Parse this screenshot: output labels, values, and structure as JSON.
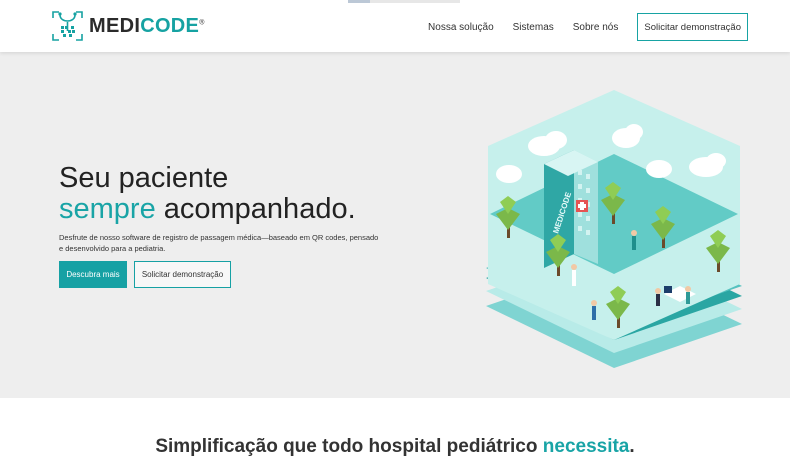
{
  "header": {
    "brand": {
      "prefix": "MEDI",
      "suffix": "CODE",
      "mark": "®"
    },
    "nav": [
      {
        "label": "Nossa solução"
      },
      {
        "label": "Sistemas"
      },
      {
        "label": "Sobre nós"
      }
    ],
    "cta_label": "Solicitar demonstração"
  },
  "hero": {
    "title_line1": "Seu paciente",
    "title_line2_accent": "sempre",
    "title_line2_rest": " acompanhado.",
    "description": "Desfrute de nosso software de registro de passagem médica—baseado em QR codes, pensado e desenvolvido para a pediatria.",
    "primary_button": "Descubra mais",
    "secondary_button": "Solicitar demonstração",
    "illustration_sign": "MEDICODE"
  },
  "section": {
    "headline_start": "Simplificação que todo hospital pediátrico ",
    "headline_accent": "necessita",
    "headline_end": "."
  },
  "colors": {
    "brand_teal": "#16a2a2",
    "hero_bg": "#eeeeee",
    "text_dark": "#222222"
  },
  "icons": {
    "logo": "medicode-qr-stethoscope-icon",
    "illustration": "isometric-hospital-illustration"
  }
}
